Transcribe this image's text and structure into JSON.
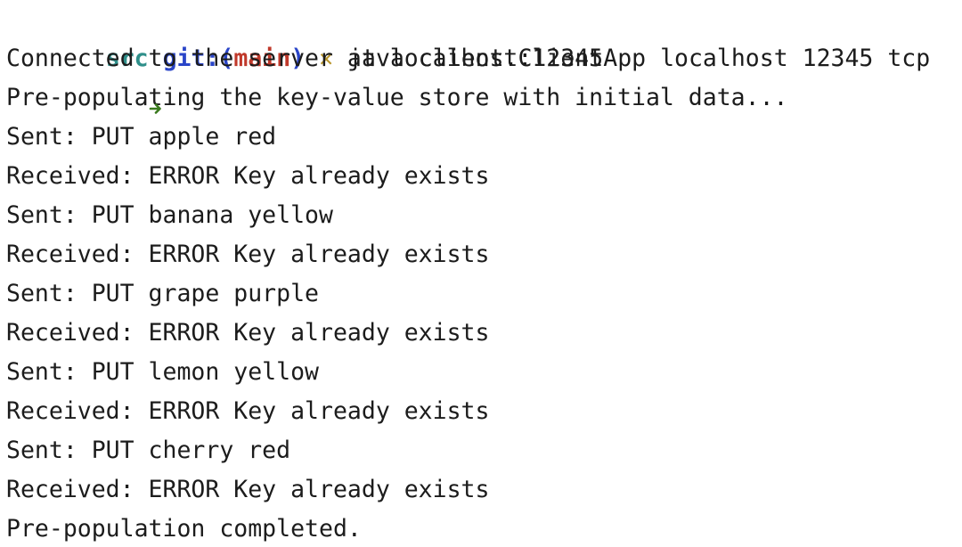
{
  "colors": {
    "arrow": "#3a7a1e",
    "dir": "#2f8f8a",
    "git": "#2a45c8",
    "branch": "#c0392b",
    "dirty": "#b8952a",
    "text": "#1c1c1c"
  },
  "prompt": {
    "arrow_icon": "right-arrow-icon",
    "dir": "src",
    "git_label": "git:(",
    "branch": "main",
    "git_close": ")",
    "dirty_mark": "✕",
    "command": "java client.ClientApp localhost 12345 tcp"
  },
  "output_lines": [
    "Connected to the server at localhost:12345",
    "Pre-populating the key-value store with initial data...",
    "Sent: PUT apple red",
    "Received: ERROR Key already exists",
    "Sent: PUT banana yellow",
    "Received: ERROR Key already exists",
    "Sent: PUT grape purple",
    "Received: ERROR Key already exists",
    "Sent: PUT lemon yellow",
    "Received: ERROR Key already exists",
    "Sent: PUT cherry red",
    "Received: ERROR Key already exists",
    "Pre-population completed."
  ]
}
